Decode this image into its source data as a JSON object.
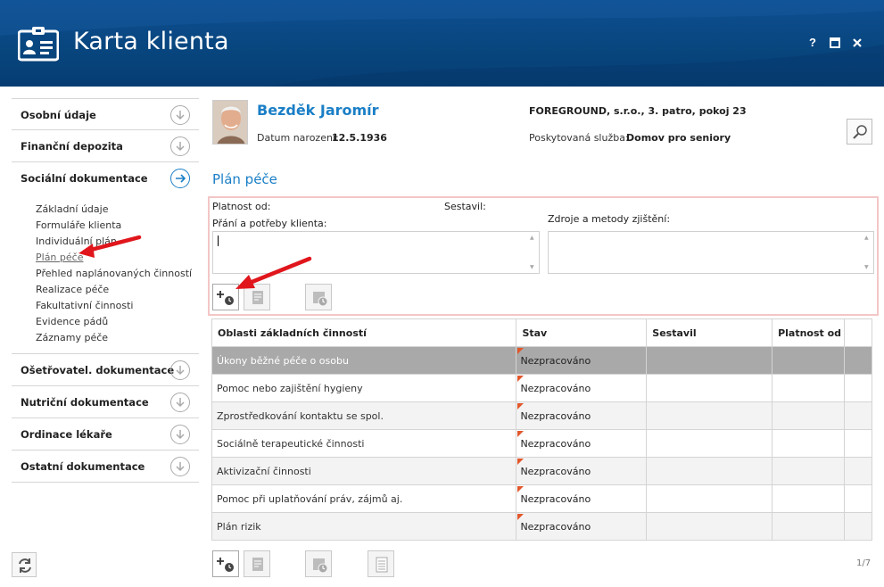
{
  "window": {
    "title": "Karta klienta",
    "buttons": {
      "help": "?",
      "maximize": "▣",
      "close": "✕"
    }
  },
  "sidebar": {
    "sections": [
      {
        "label": "Osobní údaje"
      },
      {
        "label": "Finanční depozita"
      },
      {
        "label": "Sociální dokumentace",
        "active": true
      }
    ],
    "sub_items": [
      "Základní údaje",
      "Formuláře klienta",
      "Individuální plán",
      "Plán péče",
      "Přehled naplánovaných činností",
      "Realizace péče",
      "Fakultativní činnosti",
      "Evidence pádů",
      "Záznamy péče"
    ],
    "active_sub_item": "Plán péče",
    "sections_after": [
      {
        "label": "Ošetřovatel. dokumentace"
      },
      {
        "label": "Nutriční dokumentace"
      },
      {
        "label": "Ordinace lékaře"
      },
      {
        "label": "Ostatní dokumentace"
      }
    ]
  },
  "client": {
    "name": "Bezděk Jaromír",
    "dob_label": "Datum narození:",
    "dob_value": "12.5.1936",
    "address": "FOREGROUND, s.r.o., 3. patro, pokoj 23",
    "service_label": "Poskytovaná služba:",
    "service_value": "Domov pro seniory"
  },
  "section_title": "Plán péče",
  "form": {
    "valid_from_label": "Platnost od:",
    "created_by_label": "Sestavil:",
    "wishes_label": "Přání a potřeby klienta:",
    "wishes_value": "",
    "sources_label": "Zdroje a metody zjištění:",
    "sources_value": ""
  },
  "table": {
    "columns": [
      "Oblasti základních činností",
      "Stav",
      "Sestavil",
      "Platnost od"
    ],
    "rows": [
      {
        "area": "Úkony běžné péče o osobu",
        "status": "Nezpracováno",
        "author": "",
        "valid_from": ""
      },
      {
        "area": "Pomoc nebo zajištění hygieny",
        "status": "Nezpracováno",
        "author": "",
        "valid_from": ""
      },
      {
        "area": "Zprostředkování kontaktu se spol.",
        "status": "Nezpracováno",
        "author": "",
        "valid_from": ""
      },
      {
        "area": "Sociálně terapeutické činnosti",
        "status": "Nezpracováno",
        "author": "",
        "valid_from": ""
      },
      {
        "area": "Aktivizační činnosti",
        "status": "Nezpracováno",
        "author": "",
        "valid_from": ""
      },
      {
        "area": "Pomoc při uplatňování práv, zájmů aj.",
        "status": "Nezpracováno",
        "author": "",
        "valid_from": ""
      },
      {
        "area": "Plán rizik",
        "status": "Nezpracováno",
        "author": "",
        "valid_from": ""
      }
    ]
  },
  "pager": "1/7",
  "icons": {
    "app": "client-card-icon",
    "section_expand": "chevron-down-circle-icon",
    "section_active": "arrow-right-circle-icon",
    "search": "magnifier-icon",
    "refresh": "refresh-icon",
    "add": "add-clock-icon",
    "edit": "document-icon",
    "history": "calendar-clock-icon",
    "print": "sheet-icon"
  },
  "colors": {
    "header": "#08467f",
    "accent": "#1b7fc6",
    "highlight_border": "#f4c6c6",
    "arrow": "#e0161c",
    "status_flag": "#e2572b",
    "selected_row": "#a9a9a9"
  }
}
